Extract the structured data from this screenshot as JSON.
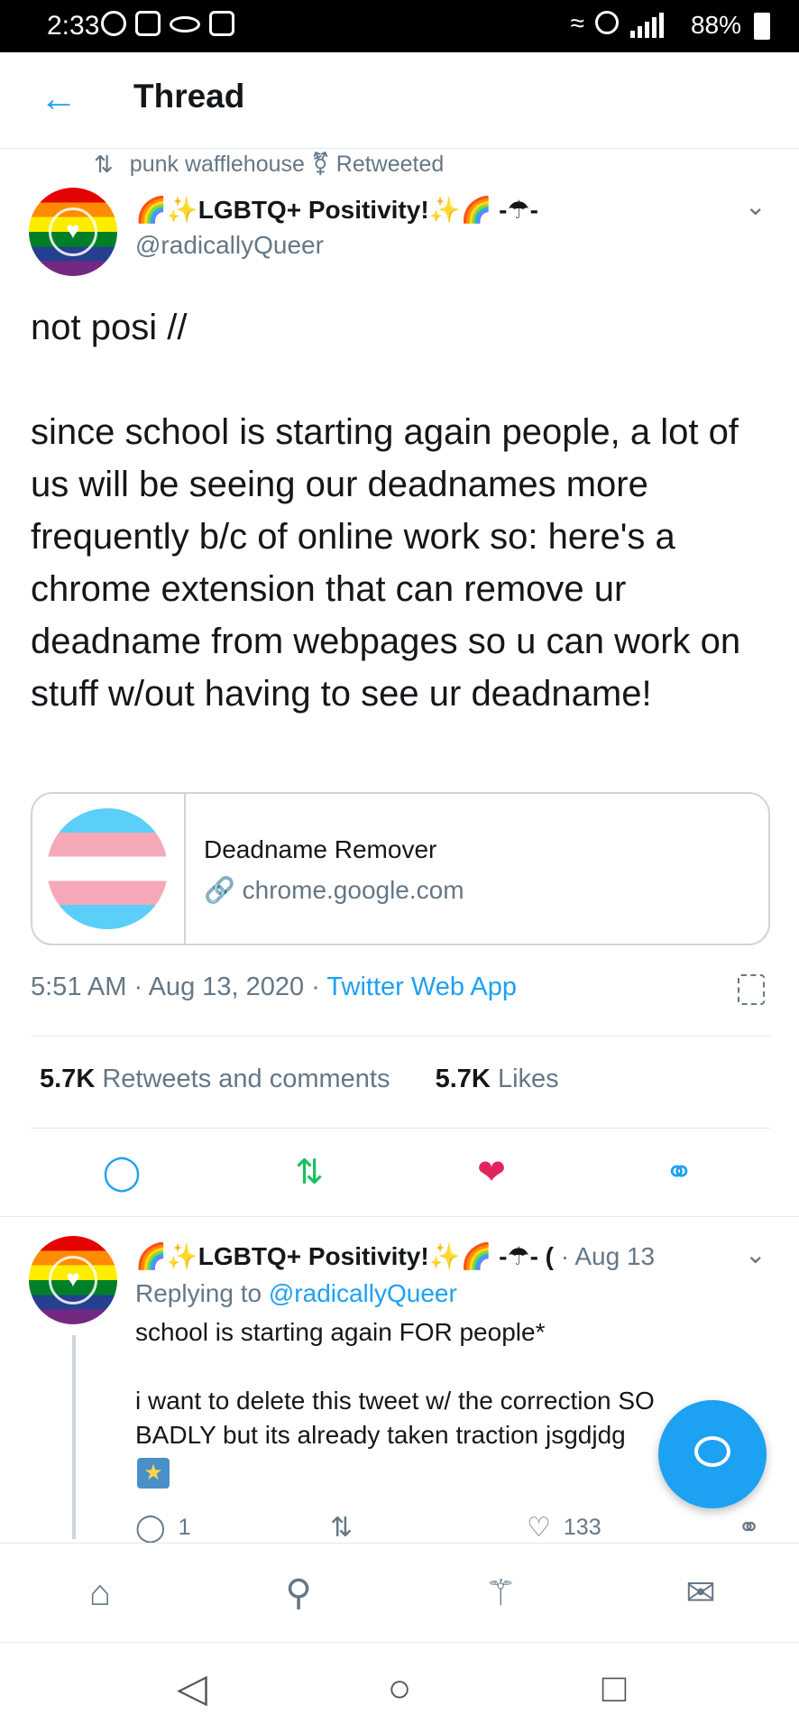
{
  "status_bar": {
    "time": "2:33",
    "battery": "88%"
  },
  "header": {
    "title": "Thread"
  },
  "retweet_note": {
    "text": "punk wafflehouse ⚧ Retweeted"
  },
  "tweet": {
    "display_name": "🌈✨LGBTQ+ Positivity!✨🌈 -☂-",
    "handle": "@radicallyQueer",
    "text": "not posi //\n\nsince school is starting again people, a lot of us will be seeing our deadnames more frequently b/c of online work so: here's a chrome extension that can remove ur deadname from webpages so u can work on stuff w/out having to see ur deadname!",
    "card": {
      "title": "Deadname Remover",
      "url": "chrome.google.com"
    },
    "time": "5:51 AM",
    "date": "Aug 13, 2020",
    "source": "Twitter Web App",
    "retweets_count": "5.7K",
    "retweets_label": "Retweets and comments",
    "likes_count": "5.7K",
    "likes_label": "Likes"
  },
  "reply": {
    "display_name": "🌈✨LGBTQ+ Positivity!✨🌈 -☂- (",
    "date": "Aug 13",
    "replying_prefix": "Replying to",
    "replying_to": "@radicallyQueer",
    "text": "school is starting again FOR people*\n\ni want to delete this tweet w/ the correction SO BADLY but its already taken traction jsgdjdg",
    "reply_count": "1",
    "like_count": "133"
  },
  "colors": {
    "accent": "#1da1f2",
    "retweet_green": "#17bf63",
    "like_red": "#e0245e"
  },
  "icons": [
    "back-arrow-icon",
    "retweet-icon",
    "chevron-down-icon",
    "link-icon",
    "analytics-icon",
    "reply-icon",
    "like-icon",
    "share-icon",
    "home-icon",
    "search-icon",
    "notifications-icon",
    "messages-icon",
    "compose-icon"
  ]
}
